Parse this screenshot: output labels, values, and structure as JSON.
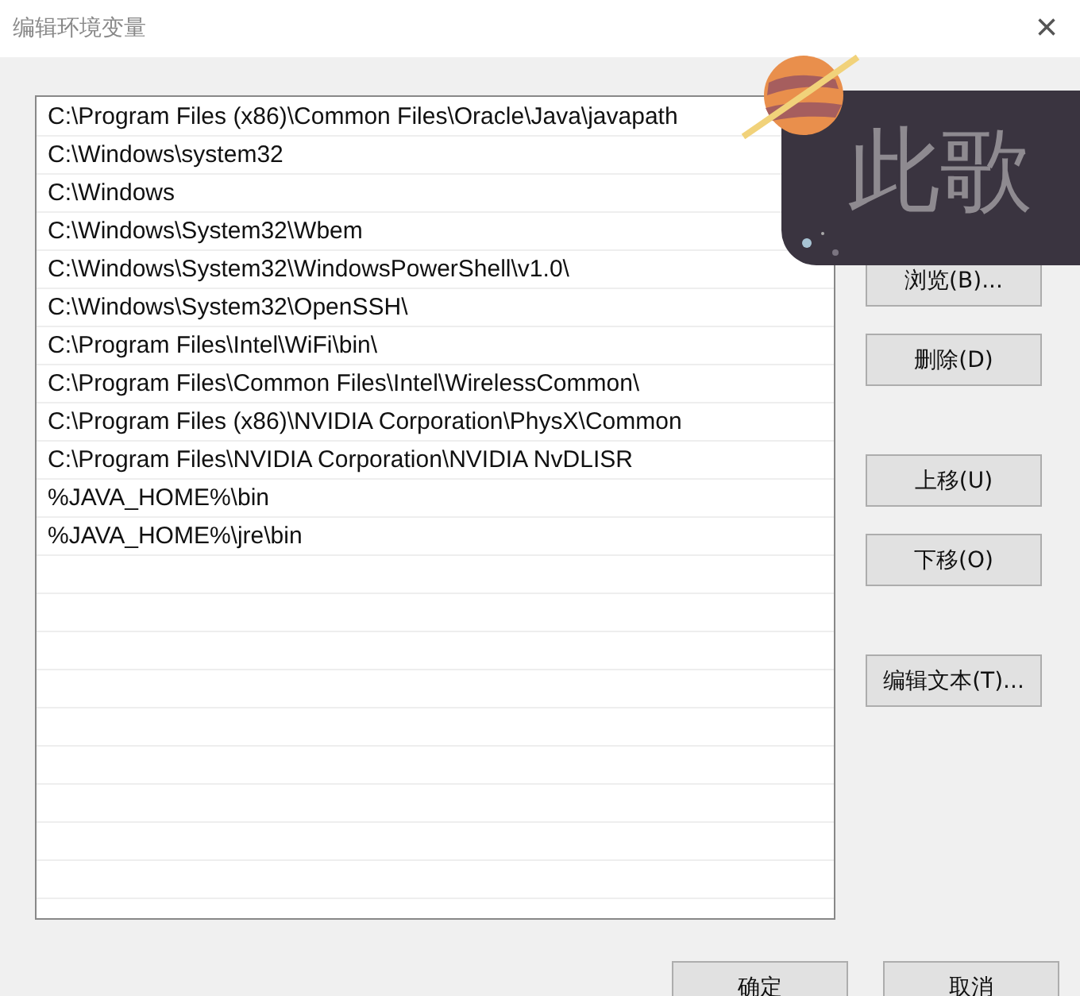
{
  "window": {
    "title": "编辑环境变量",
    "close": "×"
  },
  "paths": [
    "C:\\Program Files (x86)\\Common Files\\Oracle\\Java\\javapath",
    "C:\\Windows\\system32",
    "C:\\Windows",
    "C:\\Windows\\System32\\Wbem",
    "C:\\Windows\\System32\\WindowsPowerShell\\v1.0\\",
    "C:\\Windows\\System32\\OpenSSH\\",
    "C:\\Program Files\\Intel\\WiFi\\bin\\",
    "C:\\Program Files\\Common Files\\Intel\\WirelessCommon\\",
    "C:\\Program Files (x86)\\NVIDIA Corporation\\PhysX\\Common",
    "C:\\Program Files\\NVIDIA Corporation\\NVIDIA NvDLISR",
    "%JAVA_HOME%\\bin",
    "%JAVA_HOME%\\jre\\bin"
  ],
  "side_buttons": [
    "浏览(B)...",
    "删除(D)",
    "上移(U)",
    "下移(O)",
    "编辑文本(T)..."
  ],
  "footer_buttons": [
    "确定",
    "取消"
  ],
  "overlay": {
    "text": "此歌"
  }
}
